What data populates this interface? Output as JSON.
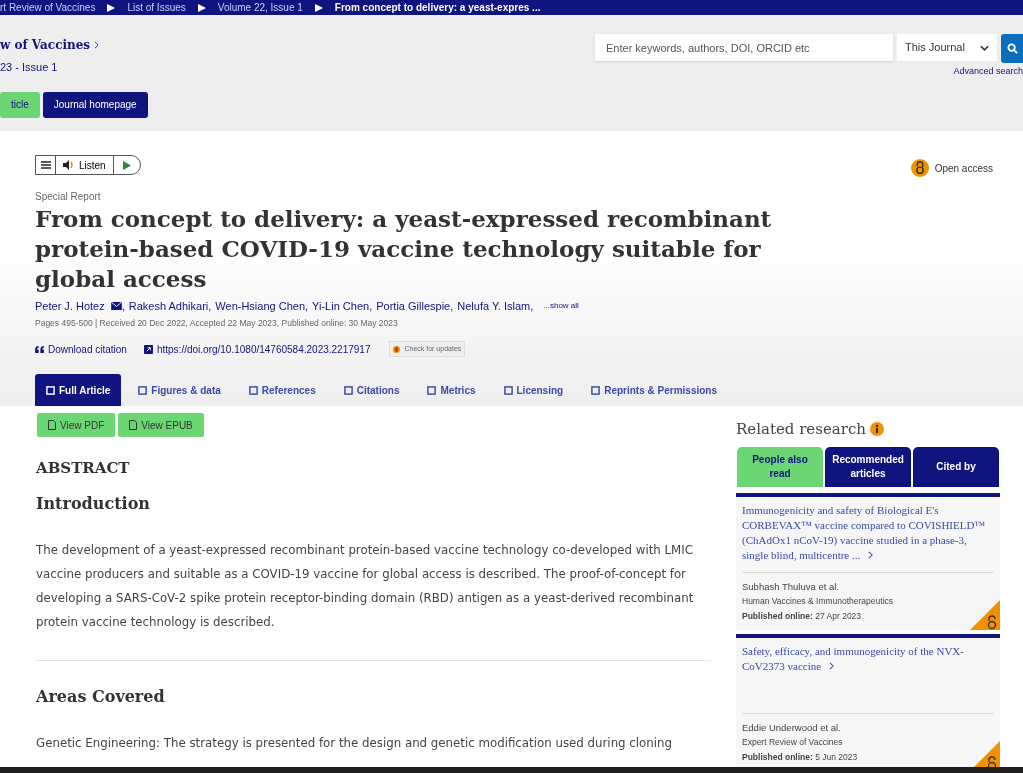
{
  "breadcrumbs": [
    "rt Review of Vaccines",
    "List of Issues",
    "Volume 22, Issue 1",
    "From concept to delivery: a yeast-expres ..."
  ],
  "journal": {
    "title": "w of Vaccines",
    "issue": "23 - Issue 1"
  },
  "header_buttons": [
    {
      "label": "ticle",
      "kind": "green"
    },
    {
      "label": "Journal homepage",
      "kind": "navy"
    }
  ],
  "search": {
    "placeholder": "Enter keywords, authors, DOI, ORCID etc",
    "scope": "This Journal",
    "advanced": "Advanced search"
  },
  "listen": {
    "label": "Listen"
  },
  "open_access": "Open access",
  "article_type": "Special Report",
  "title": "From concept to delivery: a yeast-expressed recombinant protein-based COVID-19 vaccine technology suitable for global access",
  "authors": [
    "Peter J. Hotez",
    "Rakesh Adhikari",
    "Wen-Hsiang Chen",
    "Yi-Lin Chen",
    "Portia Gillespie",
    "Nelufa Y. Islam,"
  ],
  "author_separator": ",",
  "show_all": "...show all",
  "meta": "Pages 495-500 | Received 20 Dec 2022, Accepted 22 May 2023, Published online: 30 May 2023",
  "download_citation": "Download citation",
  "doi": "https://doi.org/10.1080/14760584.2023.2217917",
  "check_updates": "Check for updates",
  "tabs": [
    {
      "label": "Full Article",
      "selected": true
    },
    {
      "label": "Figures & data",
      "selected": false
    },
    {
      "label": "References",
      "selected": false
    },
    {
      "label": "Citations",
      "selected": false
    },
    {
      "label": "Metrics",
      "selected": false
    },
    {
      "label": "Licensing",
      "selected": false
    },
    {
      "label": "Reprints & Permissions",
      "selected": false
    }
  ],
  "view_buttons": [
    "View PDF",
    "View EPUB"
  ],
  "abstract_heading": "ABSTRACT",
  "sections": [
    {
      "heading": "Introduction",
      "text": "The development of a yeast-expressed recombinant protein-based vaccine technology co-developed with LMIC vaccine producers and suitable as a COVID-19 vaccine for global access is described. The proof-of-concept for developing a SARS-CoV-2 spike protein receptor-binding domain (RBD) antigen as a yeast-derived recombinant protein vaccine technology is described."
    },
    {
      "heading": "Areas Covered",
      "text": "Genetic Engineering: The strategy is presented for the design and genetic modification used during cloning"
    }
  ],
  "related": {
    "title": "Related research",
    "tabs": [
      {
        "label": "People also read",
        "selected": true
      },
      {
        "label": "Recommended articles",
        "selected": false
      },
      {
        "label": "Cited by",
        "selected": false
      }
    ],
    "items": [
      {
        "title": "Immunogenicity and safety of Biological E's CORBEVAX™ vaccine compared to COVISHIELD™ (ChAdOx1 nCoV-19) vaccine studied in a phase-3, single blind, multicentre ...",
        "authors": "Subhash Thuluva et al.",
        "journal": "Human Vaccines & Immunotherapeutics",
        "published_label": "Published online:",
        "date": "27 Apr 2023"
      },
      {
        "title": "Safety, efficacy, and immunogenicity of the NVX-CoV2373 vaccine",
        "authors": "Eddie Underwood et al.",
        "journal": "Expert Review of Vaccines",
        "published_label": "Published online:",
        "date": "5 Jun 2023"
      }
    ]
  }
}
